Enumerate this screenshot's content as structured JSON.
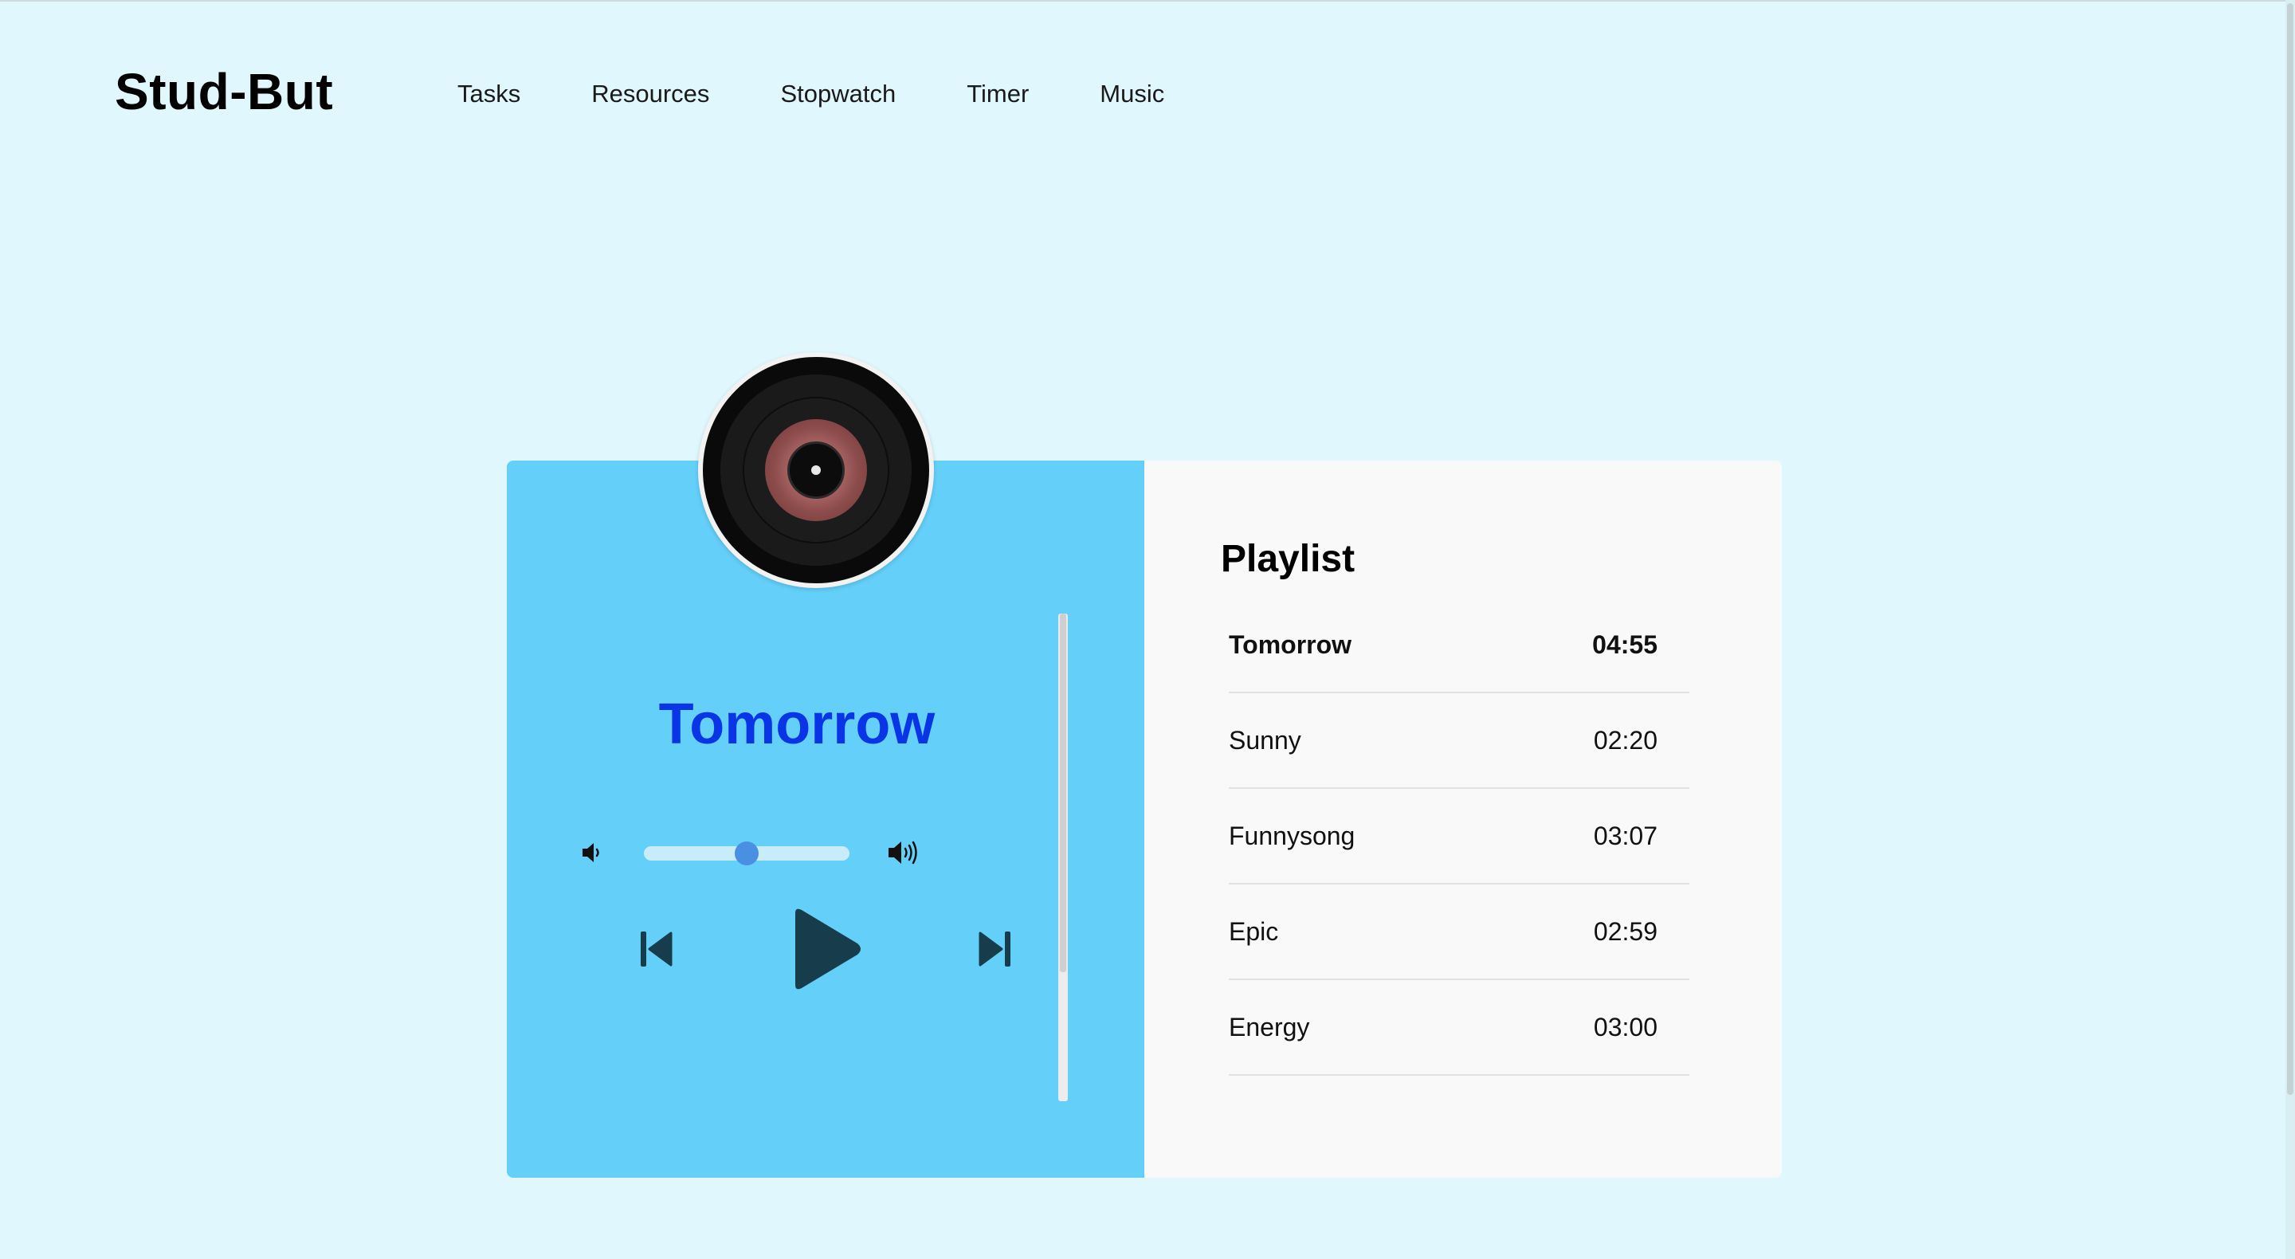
{
  "app": {
    "logo": "Stud-But"
  },
  "nav": {
    "items": [
      "Tasks",
      "Resources",
      "Stopwatch",
      "Timer",
      "Music"
    ]
  },
  "player": {
    "current_song": "Tomorrow",
    "volume_level": 0.5,
    "controls": {
      "prev_icon": "skip-previous-icon",
      "play_icon": "play-icon",
      "next_icon": "skip-next-icon",
      "volume_low_icon": "volume-low-icon",
      "volume_high_icon": "volume-high-icon"
    }
  },
  "playlist": {
    "title": "Playlist",
    "songs": [
      {
        "name": "Tomorrow",
        "duration": "04:55",
        "active": true
      },
      {
        "name": "Sunny",
        "duration": "02:20",
        "active": false
      },
      {
        "name": "Funnysong",
        "duration": "03:07",
        "active": false
      },
      {
        "name": "Epic",
        "duration": "02:59",
        "active": false
      },
      {
        "name": "Energy",
        "duration": "03:00",
        "active": false
      }
    ]
  },
  "colors": {
    "background": "#e0f7fd",
    "player_panel": "#64d0f9",
    "song_title": "#0a35e6",
    "controls": "#173d4d",
    "slider_knob": "#4a90e2"
  }
}
